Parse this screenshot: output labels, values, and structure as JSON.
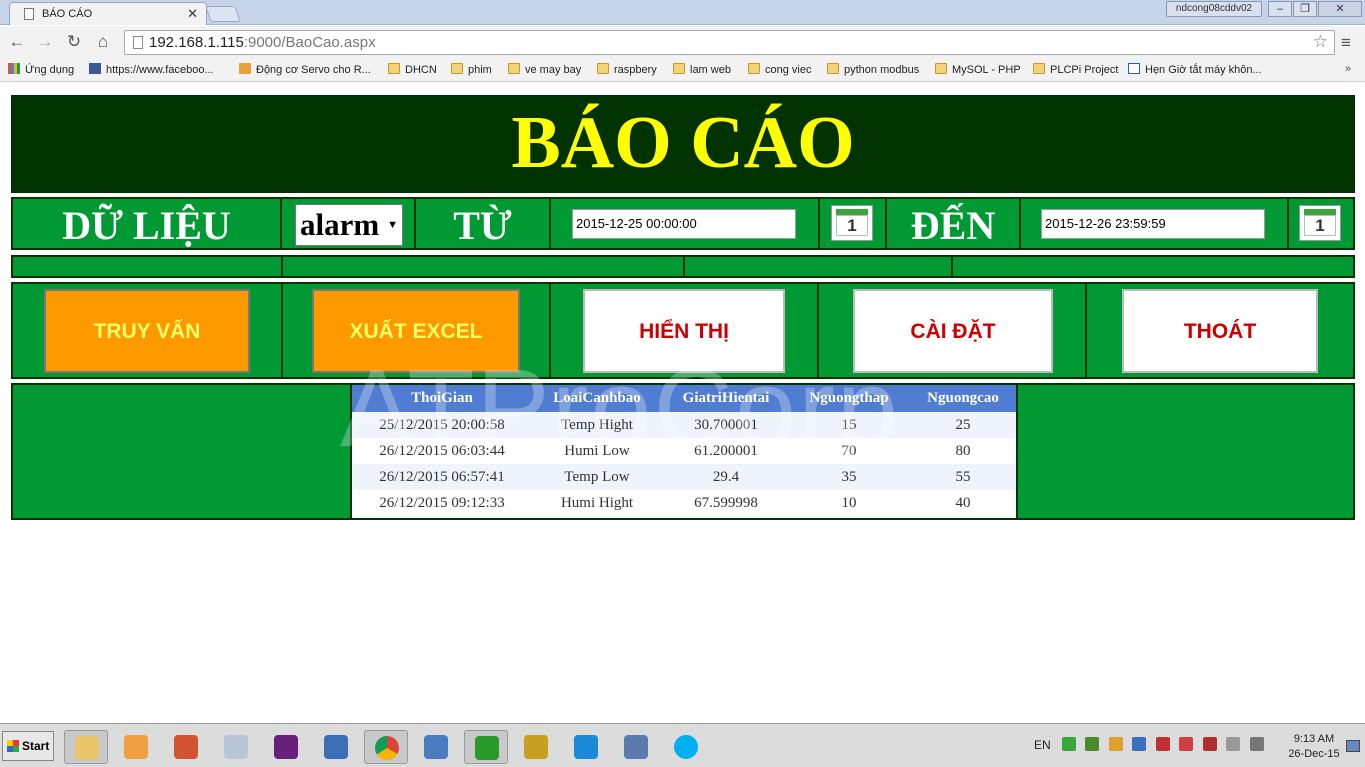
{
  "browser": {
    "tab_title": "BÁO CÁO",
    "profile_name": "ndcong08cddv02",
    "url_host": "192.168.1.115",
    "url_rest": ":9000/BaoCao.aspx",
    "bookmarks": [
      "Ứng dụng",
      "https://www.faceboo...",
      "Động cơ Servo cho R...",
      "DHCN",
      "phim",
      "ve may bay",
      "raspbery",
      "lam web",
      "cong viec",
      "python modbus",
      "MySOL - PHP",
      "PLCPi Project",
      "Hẹn Giờ tắt máy khôn..."
    ]
  },
  "page": {
    "title": "BÁO CÁO",
    "data_label": "DỮ LIỆU",
    "data_select_value": "alarm",
    "from_label": "TỪ",
    "from_value": "2015-12-25 00:00:00",
    "to_label": "ĐẾN",
    "to_value": "2015-12-26 23:59:59",
    "calendar_day": "1",
    "buttons": {
      "query": "TRUY VẤN",
      "export": "XUẤT EXCEL",
      "show": "HIỂN THỊ",
      "settings": "CÀI ĐẶT",
      "exit": "THOÁT"
    },
    "watermark": "ATProCorp",
    "table": {
      "headers": [
        "ThoiGian",
        "LoaiCanhbao",
        "GiatriHientai",
        "Nguongthap",
        "Nguongcao"
      ],
      "rows": [
        [
          "25/12/2015 20:00:58",
          "Temp Hight",
          "30.700001",
          "15",
          "25"
        ],
        [
          "26/12/2015 06:03:44",
          "Humi Low",
          "61.200001",
          "70",
          "80"
        ],
        [
          "26/12/2015 06:57:41",
          "Temp Low",
          "29.4",
          "35",
          "55"
        ],
        [
          "26/12/2015 09:12:33",
          "Humi Hight",
          "67.599998",
          "10",
          "40"
        ]
      ]
    }
  },
  "taskbar": {
    "start_label": "Start",
    "language": "EN",
    "time": "9:13 AM",
    "date": "26-Dec-15"
  },
  "colors": {
    "header_bg": "#003300",
    "row_bg": "#009933",
    "title_color": "#ffff00",
    "orange_button": "#ff9900",
    "grid_header": "#507cd1"
  }
}
